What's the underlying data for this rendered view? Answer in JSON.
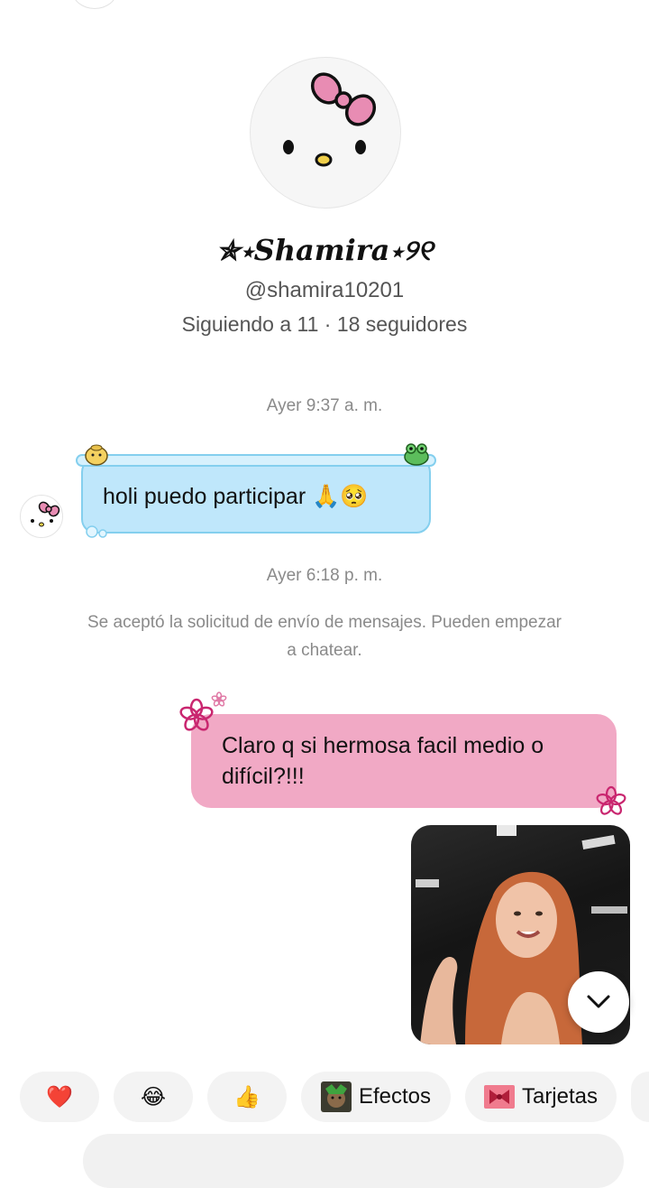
{
  "profile": {
    "name": "✯⋆𝑺𝒉𝒂𝒎𝒊𝒓𝒂⋆୨୧",
    "handle": "@shamira10201",
    "follow_stats": "Siguiendo a 11 · 18 seguidores"
  },
  "messages": {
    "timestamp_1": "Ayer 9:37 a. m.",
    "incoming_text": "holi puedo participar 🙏🥺",
    "timestamp_2": "Ayer 6:18 p. m.",
    "system_notice": "Se aceptó la solicitud de envío de mensajes. Pueden empezar a chatear.",
    "outgoing_text": "Claro q si hermosa facil medio o difícil?!!!"
  },
  "quick_reactions": {
    "heart": "❤️",
    "laugh": "😂",
    "thumbs_up": "👍",
    "effects_label": "Efectos",
    "cards_label": "Tarjetas"
  },
  "colors": {
    "incoming_bubble": "#bfe7fb",
    "outgoing_bubble": "#f1a9c5",
    "chip_background": "#f3f3f3"
  },
  "icons": {
    "scroll_down": "chevron-down-icon",
    "avatar": "hello-kitty-face",
    "effects": "effects-thumbnail",
    "cards": "gift-card-thumbnail"
  }
}
